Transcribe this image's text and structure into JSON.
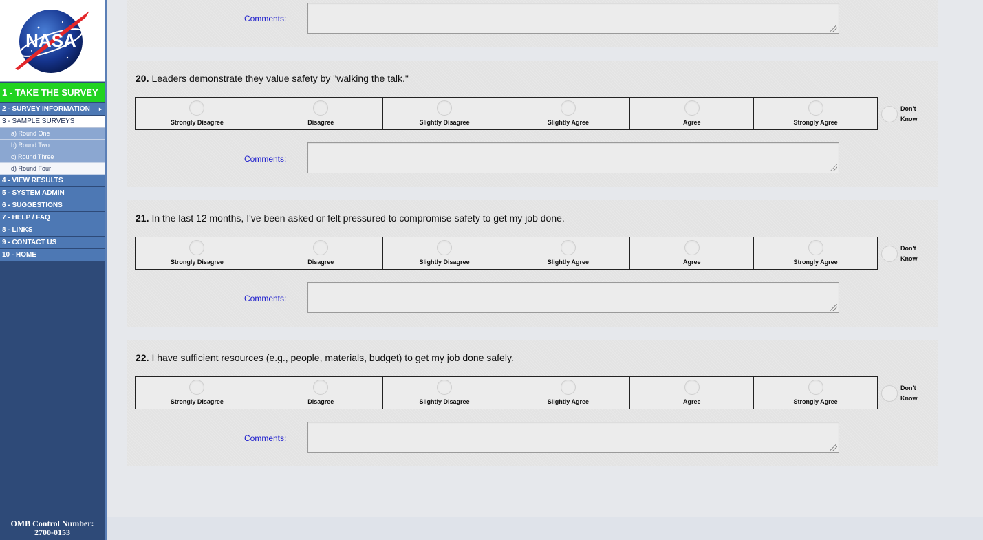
{
  "sidebar": {
    "logo_text": "NASA",
    "take_survey": "1 - TAKE THE SURVEY",
    "menu": [
      {
        "label": "2 - SURVEY INFORMATION",
        "style": "top",
        "arrow": "▸"
      },
      {
        "label": "3 - SAMPLE SURVEYS",
        "style": "light"
      },
      {
        "label": "a)  Round One",
        "style": "sub"
      },
      {
        "label": "b)  Round Two",
        "style": "sub"
      },
      {
        "label": "c)  Round Three",
        "style": "sub"
      },
      {
        "label": "d)  Round Four",
        "style": "sub-active"
      },
      {
        "label": "4 - VIEW RESULTS",
        "style": "top"
      },
      {
        "label": "5 - SYSTEM ADMIN",
        "style": "top"
      },
      {
        "label": "6 - SUGGESTIONS",
        "style": "top"
      },
      {
        "label": "7 - HELP / FAQ",
        "style": "top"
      },
      {
        "label": "8 - LINKS",
        "style": "top"
      },
      {
        "label": "9 - CONTACT US",
        "style": "top"
      },
      {
        "label": "10 - HOME",
        "style": "top"
      }
    ],
    "omb_line1": "OMB Control Number:",
    "omb_line2": "2700-0153"
  },
  "scale_labels": [
    "Strongly Disagree",
    "Disagree",
    "Slightly Disagree",
    "Slightly Agree",
    "Agree",
    "Strongly Agree"
  ],
  "dont_know": {
    "line1": "Don't",
    "line2": "Know"
  },
  "comments_label": "Comments:",
  "questions": [
    {
      "number": "20.",
      "text": "Leaders demonstrate they value safety by \"walking the talk.\""
    },
    {
      "number": "21.",
      "text": "In the last 12 months, I've been asked or felt pressured to compromise safety to get my job done."
    },
    {
      "number": "22.",
      "text": "I have sufficient resources (e.g., people, materials, budget) to get my job done safely."
    }
  ],
  "colors": {
    "sidebar_bg": "#2e4a78",
    "menu_blue": "#4d78b4",
    "take_survey_green": "#21d321",
    "comments_label": "#1a1acc"
  }
}
